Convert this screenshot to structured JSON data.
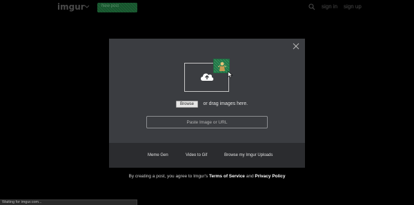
{
  "header": {
    "logo": "imgur",
    "new_post_label": "New post",
    "signin": "sign in",
    "signup": "sign up"
  },
  "modal": {
    "drag_text": "or drag images here.",
    "browse_label": "Browse",
    "url_placeholder": "Paste Image or URL",
    "footer": {
      "meme_gen": "Meme Gen",
      "video_to_gif": "Video to Gif",
      "browse_uploads": "Browse my Imgur Uploads"
    }
  },
  "terms": {
    "prefix": "By creating a post, you agree to Imgur's ",
    "terms_of_service": "Terms of Service",
    "and": " and ",
    "privacy_policy": "Privacy Policy"
  },
  "status": {
    "text": "Waiting for imgur.com..."
  },
  "colors": {
    "modal_bg": "#3b3d41",
    "footer_bg": "#2b2c2f",
    "new_post_green": "#1b5e33",
    "thumb_green": "#2e8b57"
  },
  "icons": [
    "chevron-down-icon",
    "search-icon",
    "close-icon",
    "cloud-upload-icon",
    "cursor-icon"
  ]
}
